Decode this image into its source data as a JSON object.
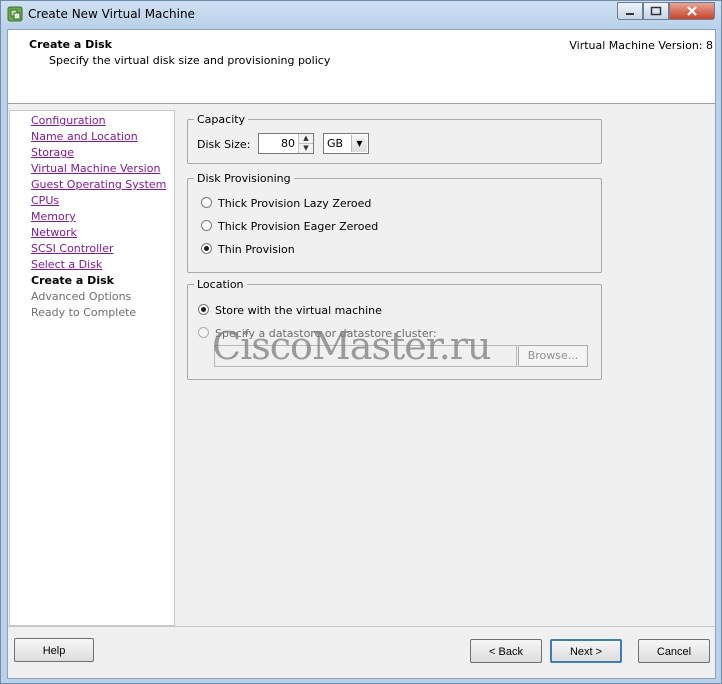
{
  "window": {
    "title": "Create New Virtual Machine"
  },
  "header": {
    "title": "Create a Disk",
    "subtitle": "Specify the virtual disk size and provisioning policy",
    "version": "Virtual Machine Version: 8"
  },
  "nav": {
    "items": [
      {
        "label": "Configuration",
        "state": "link"
      },
      {
        "label": "Name and Location",
        "state": "link"
      },
      {
        "label": "Storage",
        "state": "link"
      },
      {
        "label": "Virtual Machine Version",
        "state": "link"
      },
      {
        "label": "Guest Operating System",
        "state": "link"
      },
      {
        "label": "CPUs",
        "state": "link"
      },
      {
        "label": "Memory",
        "state": "link"
      },
      {
        "label": "Network",
        "state": "link"
      },
      {
        "label": "SCSI Controller",
        "state": "link"
      },
      {
        "label": "Select a Disk",
        "state": "link"
      },
      {
        "label": "Create a Disk",
        "state": "current"
      },
      {
        "label": "Advanced Options",
        "state": "disabled"
      },
      {
        "label": "Ready to Complete",
        "state": "disabled"
      }
    ]
  },
  "capacity": {
    "title": "Capacity",
    "disk_size_label": "Disk Size:",
    "disk_size_value": "80",
    "unit_value": "GB"
  },
  "provisioning": {
    "title": "Disk Provisioning",
    "options": [
      {
        "label": "Thick Provision Lazy Zeroed",
        "selected": false
      },
      {
        "label": "Thick Provision Eager Zeroed",
        "selected": false
      },
      {
        "label": "Thin Provision",
        "selected": true
      }
    ]
  },
  "location": {
    "title": "Location",
    "options": [
      {
        "label": "Store with the virtual machine",
        "selected": true
      },
      {
        "label": "Specify a datastore or datastore cluster:",
        "selected": false
      }
    ],
    "browse_label": "Browse..."
  },
  "watermark": {
    "text": "CiscoMaster.ru"
  },
  "footer": {
    "help_label": "Help",
    "back_label": "< Back",
    "next_label": "Next >",
    "cancel_label": "Cancel"
  },
  "colors": {
    "link": "#7f1a9a",
    "titlebar": "#b9d1ea",
    "close": "#c7432b"
  }
}
